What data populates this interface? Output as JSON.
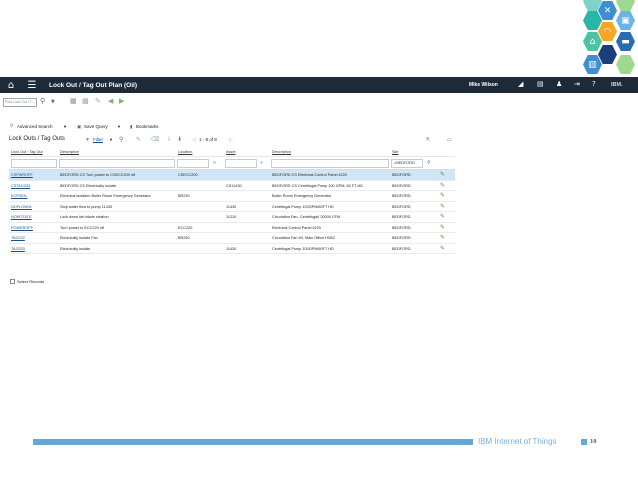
{
  "decor": {
    "hex_colors": [
      "#7ed3c9",
      "#3d8fd1",
      "#1c3f7a",
      "#6cb3e8",
      "#9fd88f",
      "#f6a623",
      "#4fc3a1",
      "#2b6cb0",
      "#2bb5a9"
    ],
    "icons": [
      "close-icon",
      "wifi-icon",
      "bus-icon",
      "house-icon",
      "car-icon",
      "factory-icon"
    ]
  },
  "topbar": {
    "title": "Lock Out / Tag Out Plan (Oil)",
    "user": "Mike Wilson",
    "brand": "IBM."
  },
  "toolbar2": {
    "find_placeholder": "Find Lock Out / T..."
  },
  "toolbar3": {
    "advanced_search": "Advanced Search",
    "save_query": "Save Query",
    "bookmarks": "Bookmarks"
  },
  "section": {
    "title": "Lock Outs / Tag Outs",
    "filter": "Filter",
    "pagination": "1 - 8 of 8"
  },
  "columns": [
    "Lock Out / Tag Out",
    "Description",
    "Location",
    "Asset",
    "Description",
    "Site"
  ],
  "filter_row": {
    "site_value": "=BEDFORD"
  },
  "rows": [
    {
      "id": "CSPWROFF",
      "desc": "BEDFORD CS Turn power to CSECC200 off",
      "location": "CSECC200",
      "asset": "",
      "asset_desc": "BEDFORD CS Electrical Control Panel #220",
      "site": "BEDFORD"
    },
    {
      "id": "CSTAG333",
      "desc": "BEDFORD CS Electrically isolate",
      "location": "",
      "asset": "CS11430",
      "asset_desc": "BEDFORD CS Centrifugal Pump 100 GPM, 60 FT-HD",
      "site": "BEDFORD"
    },
    {
      "id": "ECPISOL",
      "desc": "Electrical isolation Boiler Room Emergency Generator",
      "location": "BR230",
      "asset": "",
      "asset_desc": "Boiler Room Emergency Generator",
      "site": "BEDFORD"
    },
    {
      "id": "NOFLOW01",
      "desc": "Stop water flow to pump 11430",
      "location": "",
      "asset": "11430",
      "asset_desc": "Centrifugal Pump 100GPM/60FT HD",
      "site": "BEDFORD"
    },
    {
      "id": "NOROTATE",
      "desc": "Lock down fan blade rotation",
      "location": "",
      "asset": "11210",
      "asset_desc": "Circulation Fan- Centrifugal/ 20000 CFM",
      "site": "BEDFORD"
    },
    {
      "id": "POWEROFF",
      "desc": "Turn power to ECC220 off",
      "location": "ECC220",
      "asset": "",
      "asset_desc": "Electrical Control Panel #220",
      "site": "BEDFORD"
    },
    {
      "id": "TAG222",
      "desc": "Electrically isolate Fan",
      "location": "BR250",
      "asset": "",
      "asset_desc": "Circulation Fan #3, Main Office HVAC",
      "site": "BEDFORD"
    },
    {
      "id": "TAG333",
      "desc": "Electrically isolate",
      "location": "",
      "asset": "11430",
      "asset_desc": "Centrifugal Pump 100GPM/60FT HD",
      "site": "BEDFORD"
    }
  ],
  "select_records": "Select Records",
  "footer": {
    "label": "IBM Internet of Things",
    "page": "10",
    "accent": "#64a6d8"
  }
}
